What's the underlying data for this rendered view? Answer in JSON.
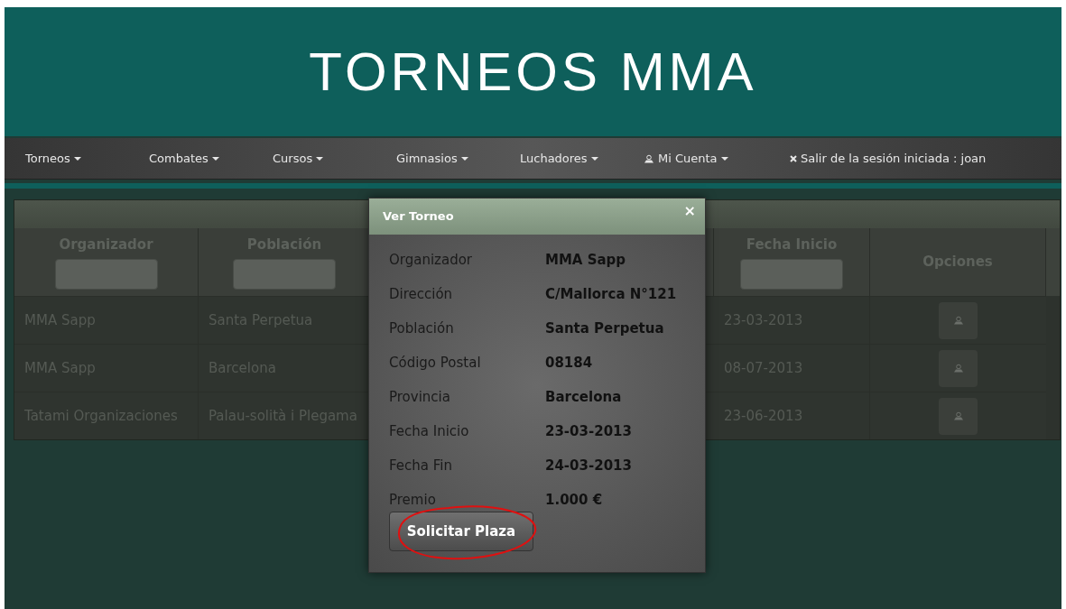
{
  "header": {
    "logo": "TORNEOS MMA"
  },
  "nav": {
    "items": [
      {
        "label": "Torneos",
        "caret": true
      },
      {
        "label": "Combates",
        "caret": true
      },
      {
        "label": "Cursos",
        "caret": true
      },
      {
        "label": "Gimnasios",
        "caret": true
      },
      {
        "label": "Luchadores",
        "caret": true
      },
      {
        "label": "Mi Cuenta",
        "caret": true,
        "kind": "account"
      },
      {
        "label": "Salir de la sesión iniciada : joan",
        "caret": false,
        "kind": "logout"
      }
    ]
  },
  "table": {
    "columns": [
      {
        "label": "Organizador",
        "filter": true
      },
      {
        "label": "Población",
        "filter": true
      },
      {
        "label": "Fecha Inicio",
        "filter": true
      },
      {
        "label": "Opciones",
        "filter": false
      }
    ],
    "rows": [
      [
        "MMA Sapp",
        "Santa Perpetua",
        "23-03-2013"
      ],
      [
        "MMA Sapp",
        "Barcelona",
        "08-07-2013"
      ],
      [
        "Tatami Organizaciones",
        "Palau-solità i Plegama",
        "23-06-2013"
      ]
    ]
  },
  "modal": {
    "title": "Ver Torneo",
    "close": "×",
    "fields": [
      {
        "label": "Organizador",
        "value": "MMA Sapp"
      },
      {
        "label": "Dirección",
        "value": "C/Mallorca N°121"
      },
      {
        "label": "Población",
        "value": "Santa Perpetua"
      },
      {
        "label": "Código Postal",
        "value": "08184"
      },
      {
        "label": "Provincia",
        "value": "Barcelona"
      },
      {
        "label": "Fecha Inicio",
        "value": "23-03-2013"
      },
      {
        "label": "Fecha Fin",
        "value": "24-03-2013"
      },
      {
        "label": "Premio",
        "value": "1.000 €"
      }
    ],
    "button": "Solicitar Plaza",
    "highlighted": true
  }
}
